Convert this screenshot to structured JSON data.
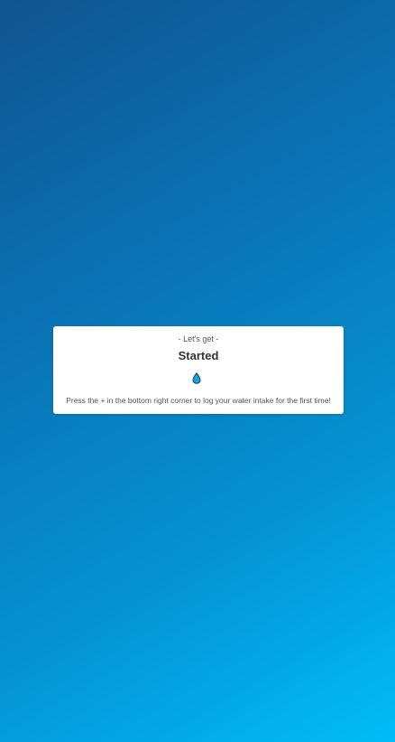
{
  "card": {
    "eyebrow": "- Let's get -",
    "title": "Started",
    "icon": "water-drop-icon",
    "message": "Press the + in the bottom right corner to log your water intake for the first time!"
  },
  "colors": {
    "background_start": "#10548f",
    "background_end": "#00bdf7",
    "card": "#ffffff",
    "drop_fill": "#1aa3dc",
    "drop_outline": "#0d3f5e"
  }
}
